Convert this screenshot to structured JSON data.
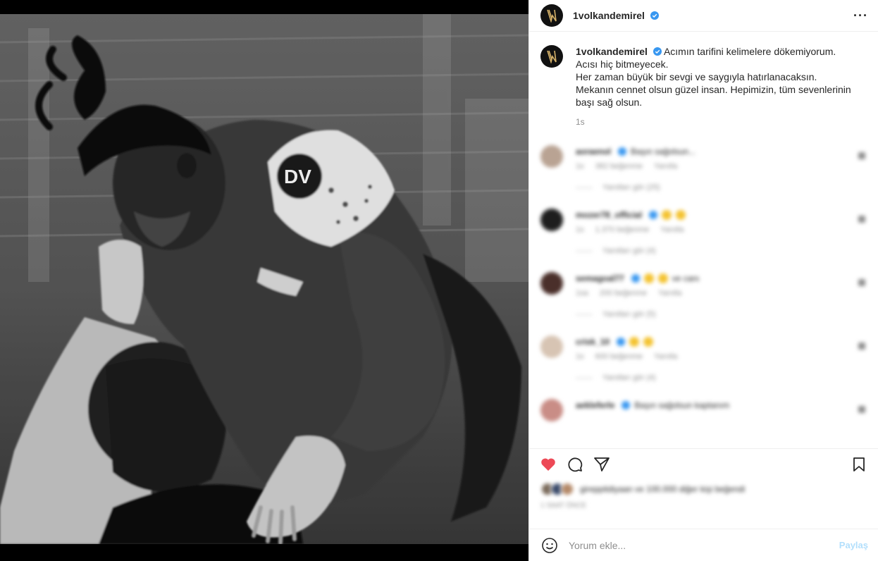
{
  "post": {
    "username": "1volkandemirel",
    "caption_lines": [
      "Acımın tarifini kelimelere dökemiyorum.",
      "Acısı hiç bitmeyecek.",
      "Her zaman büyük bir sevgi ve saygıyla hatırlanacaksın.",
      "Mekanın cennet olsun güzel insan. Hepimizin, tüm sevenlerinin",
      "başı sağ olsun."
    ],
    "time": "1s",
    "jersey_text": "DV"
  },
  "comments": [
    {
      "user": "aoraenol",
      "text": "Başın sağolsun...",
      "age": "1s",
      "likes": "382 beğenme",
      "reply": "Yanıtla",
      "view_replies": "Yanıtları gör (25)",
      "avatar_color": "#b9a393",
      "emoji": false
    },
    {
      "user": "mozer78_official",
      "text": "",
      "age": "1s",
      "likes": "1.370 beğenme",
      "reply": "Yanıtla",
      "view_replies": "Yanıtları gör (4)",
      "avatar_color": "#1e1e1e",
      "emoji": true
    },
    {
      "user": "semagoal77",
      "text": "ve canı",
      "age": "1sa",
      "likes": "200 beğenme",
      "reply": "Yanıtla",
      "view_replies": "Yanıtları gör (5)",
      "avatar_color": "#4a2f2a",
      "emoji": true
    },
    {
      "user": "crisk_10",
      "text": "",
      "age": "1s",
      "likes": "600 beğenme",
      "reply": "Yanıtla",
      "view_replies": "Yanıtları gör (4)",
      "avatar_color": "#d7c4b3",
      "emoji": true
    },
    {
      "user": "aekleferle",
      "text": "Başın sağolsun kaptanım",
      "age": "",
      "likes": "",
      "reply": "",
      "view_replies": "",
      "avatar_color": "#c98d86",
      "emoji": false
    }
  ],
  "likes": {
    "text": "gireppitdiyaan ve 100.000 diğer kişi beğendi",
    "date": "1 saat önce",
    "avatar_colors": [
      "#7a6a5a",
      "#3a4a6a",
      "#b58a6a"
    ]
  },
  "add_comment": {
    "placeholder": "Yorum ekle...",
    "share_label": "Paylaş"
  },
  "colors": {
    "verified": "#3897f0",
    "like_red": "#ed4956",
    "share_disabled": "#b2dffc"
  },
  "icons": {
    "more": "more-icon",
    "heart": "heart-icon",
    "comment": "comment-icon",
    "share": "share-icon",
    "bookmark": "bookmark-icon",
    "emoji": "emoji-icon"
  }
}
